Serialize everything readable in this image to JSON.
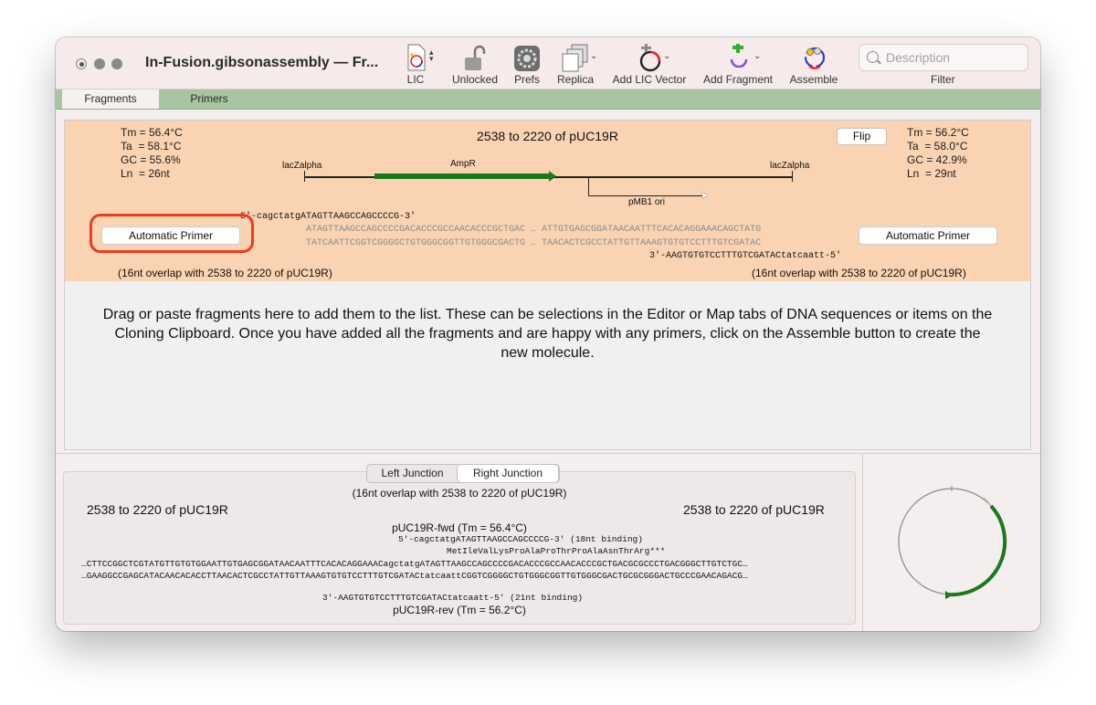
{
  "window": {
    "title": "In-Fusion.gibsonassembly — Fr..."
  },
  "toolbar": {
    "lic": "LIC",
    "unlocked": "Unlocked",
    "prefs": "Prefs",
    "replica": "Replica",
    "add_lic_vector": "Add LIC Vector",
    "add_fragment": "Add Fragment",
    "assemble": "Assemble",
    "search_placeholder": "Description",
    "filter": "Filter"
  },
  "tabs": {
    "fragments": "Fragments",
    "primers": "Primers"
  },
  "fragment": {
    "title": "2538 to 2220 of pUC19R",
    "left_stats": "Tm = 56.4°C\nTa  = 58.1°C\nGC = 55.6%\nLn  = 26nt",
    "right_stats": "Tm = 56.2°C\nTa  = 58.0°C\nGC = 42.9%\nLn  = 29nt",
    "flip": "Flip",
    "map": {
      "lac_left": "lacZalpha",
      "ampr": "AmpR",
      "lac_right": "lacZalpha",
      "ori": "pMB1 ori"
    },
    "primer_fwd_top": "5'-cagctatgATAGTTAAGCCAGCCCCG-3'",
    "top_strand": "ATAGTTAAGCCAGCCCCGACACCCGCCAACACCCGCTGAC … ATTGTGAGCGGATAACAATTTCACACAGGAAACAGCTATG",
    "bottom_strand": "TATCAATTCGGTCGGGGCTGTGGGCGGTTGTGGGCGACTG … TAACACTCGCCTATTGTTAAAGTGTGTCCTTTGTCGATAC",
    "primer_rev_bottom": "3'-AAGTGTGTCCTTTGTCGATACtatcaatt-5'",
    "auto_primer_left": "Automatic Primer",
    "auto_primer_right": "Automatic Primer",
    "overlap_left": "(16nt overlap with 2538 to 2220 of pUC19R)",
    "overlap_right": "(16nt overlap with 2538 to 2220 of pUC19R)"
  },
  "drag_text": "Drag or paste fragments here to add them to the list. These can be selections in the Editor or Map tabs of DNA sequences or items on the Cloning Clipboard.  Once you have added all the fragments and are happy with any primers, click on the Assemble button to create the new molecule.",
  "junction": {
    "left_tab": "Left Junction",
    "right_tab": "Right Junction",
    "overlap": "(16nt overlap with 2538 to 2220 of pUC19R)",
    "left_name": "2538 to 2220 of pUC19R",
    "right_name": "2538 to 2220 of pUC19R",
    "fwd_name": "pUC19R-fwd (Tm = 56.4°C)",
    "fwd_seq": "5'-cagctatgATAGTTAAGCCAGCCCCG-3' (18nt binding)",
    "translation": "MetIleValLysProAlaProThrProAlaAsnThrArg***",
    "top_seq": "…CTTCCGGCTCGTATGTTGTGTGGAATTGTGAGCGGATAACAATTTCACACAGGAAACagctatgATAGTTAAGCCAGCCCCGACACCCGCCAACACCCGCTGACGCGCCCTGACGGGCTTGTCTGC…",
    "bottom_seq": "…GAAGGCCGAGCATACAACACACCTTAACACTCGCCTATTGTTAAAGTGTGTCCTTTGTCGATACtatcaattCGGTCGGGGCTGTGGGCGGTTGTGGGCGACTGCGCGGGACTGCCCGAACAGACG…",
    "rev_seq": "3'-AAGTGTGTCCTTTGTCGATACtatcaatt-5' (21nt binding)",
    "rev_name": "pUC19R-rev (Tm = 56.2°C)"
  },
  "colors": {
    "fragment_bg": "#fad4b2",
    "tab_bar": "#a7c5a1",
    "feature_green": "#1a7a1a",
    "highlight_red": "#ee3b1f"
  }
}
